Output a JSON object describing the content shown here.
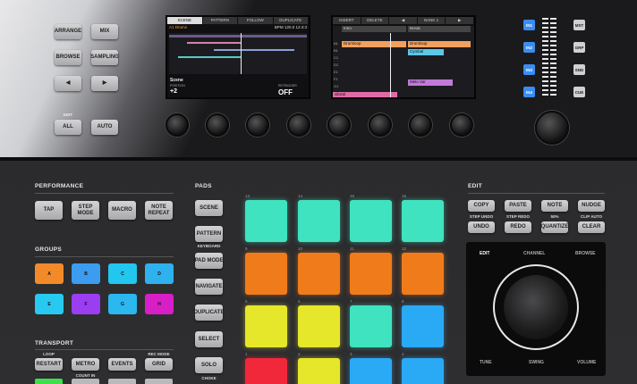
{
  "top_buttons": {
    "arrange": "ARRANGE",
    "mix": "MIX",
    "browse": "BROWSE",
    "sampling": "SAMPLING",
    "left": "◀",
    "right": "▶",
    "all": "ALL",
    "auto": "AUTO",
    "edit_label": "EDIT"
  },
  "left_screen": {
    "tabs": [
      "SCENE",
      "PATTERN",
      "FOLLOW",
      "DUPLICATE"
    ],
    "track": "A1 Drums",
    "bpm_label": "BPM",
    "bpm": "120.0",
    "pos": "12:4:3",
    "scene_label": "Scene",
    "position_label": "POSITION",
    "position_value": "+2",
    "retrigger_label": "RETRIGGER",
    "retrigger_value": "OFF"
  },
  "right_screen": {
    "tabs": [
      "INSERT",
      "DELETE",
      "◀",
      "BANK 1",
      "▶"
    ],
    "cols": [
      "Intro",
      "Break"
    ],
    "rows": [
      "A1",
      "B1",
      "C1",
      "D1",
      "E1",
      "F1",
      "G1",
      "H1"
    ],
    "clips": [
      "Drumloop",
      "Drumloop",
      "Cymbal",
      "Melo Var",
      "vibrati"
    ]
  },
  "input_buttons": [
    "IN1",
    "IN2",
    "IN3",
    "IN4"
  ],
  "side_buttons": [
    "MST",
    "GRP",
    "SND",
    "CUE"
  ],
  "performance": {
    "title": "PERFORMANCE",
    "tap": "TAP",
    "step_mode": "STEP\nMODE",
    "macro": "MACRO",
    "note_repeat": "NOTE\nREPEAT"
  },
  "groups": {
    "title": "GROUPS",
    "items": [
      "A",
      "B",
      "C",
      "D",
      "E",
      "F",
      "G",
      "H"
    ],
    "colors": [
      "#f28a2a",
      "#3b9cf0",
      "#21c7ee",
      "#2fb1ee",
      "#27c9f0",
      "#9b3df0",
      "#2bb7f0",
      "#d81fc7"
    ]
  },
  "transport": {
    "title": "TRANSPORT",
    "loop": "LOOP",
    "restart": "RESTART",
    "metro": "METRO",
    "events": "EVENTS",
    "rec_mode": "REC MODE",
    "grid": "GRID",
    "count_in": "COUNT IN"
  },
  "pads_section": {
    "title": "PADS",
    "scene": "SCENE",
    "pattern": "PATTERN",
    "keyboard": "KEYBOARD",
    "pad_mode": "PAD MODE",
    "navigate": "NAVIGATE",
    "duplicate": "DUPLICATE",
    "select": "SELECT",
    "solo": "SOLO",
    "choke": "CHOKE"
  },
  "pad_numbers": [
    "13",
    "14",
    "15",
    "16",
    "9",
    "10",
    "11",
    "12",
    "5",
    "6",
    "7",
    "8",
    "1",
    "2",
    "3",
    "4"
  ],
  "pad_colors": [
    "#3fe3c0",
    "#3fe3c0",
    "#3fe3c0",
    "#3fe3c0",
    "#f07b1a",
    "#f07b1a",
    "#f07b1a",
    "#f07b1a",
    "#e6e62a",
    "#e6e62a",
    "#3fe3c0",
    "#2aa9f5",
    "#f0283a",
    "#e6e62a",
    "#2aa9f5",
    "#2aa9f5"
  ],
  "edit": {
    "title": "EDIT",
    "copy": "COPY",
    "paste": "PASTE",
    "note": "NOTE",
    "nudge": "NUDGE",
    "step_undo": "STEP UNDO",
    "step_redo": "STEP REDO",
    "fifty": "50%",
    "clip_auto": "CLIP AUTO",
    "undo": "UNDO",
    "redo": "REDO",
    "quantize": "QUANTIZE",
    "clear": "CLEAR"
  },
  "encoder": {
    "edit": "EDIT",
    "channel": "CHANNEL",
    "browse": "BROWSE",
    "tune": "TUNE",
    "swing": "SWING",
    "volume": "VOLUME"
  }
}
